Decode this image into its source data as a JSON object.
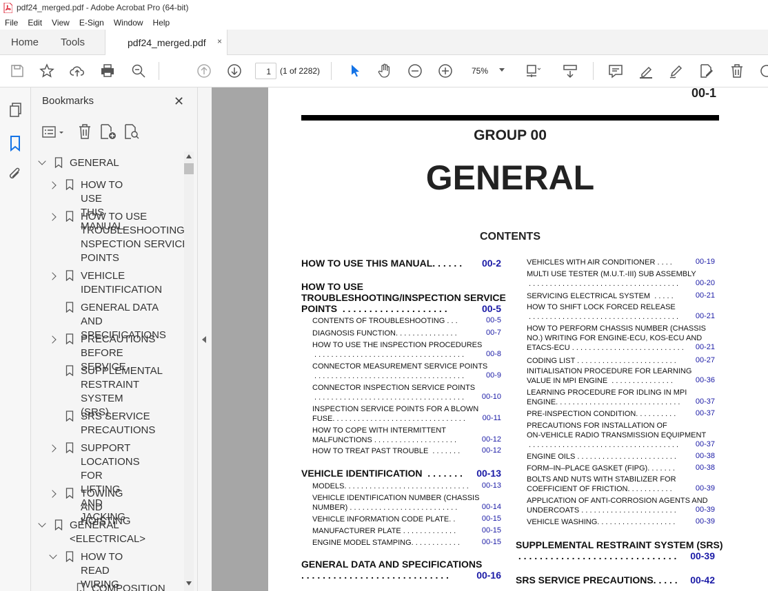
{
  "window": {
    "title": "pdf24_merged.pdf - Adobe Acrobat Pro (64-bit)"
  },
  "menu": [
    "File",
    "Edit",
    "View",
    "E-Sign",
    "Window",
    "Help"
  ],
  "tabs": {
    "home": "Home",
    "tools": "Tools",
    "doc": "pdf24_merged.pdf",
    "close": "×"
  },
  "toolbar": {
    "page": "1",
    "page_count": "(1 of 2282)",
    "zoom": "75%"
  },
  "bookmarks": {
    "title": "Bookmarks",
    "close": "✕",
    "items": [
      {
        "label": "GENERAL",
        "level": 0,
        "state": "open"
      },
      {
        "label": "HOW TO USE THIS\nMANUAL",
        "level": 1,
        "state": "closed"
      },
      {
        "label": "HOW TO USE\nTROUBLESHOOTING/I\nNSPECTION SERVICE\nPOINTS",
        "level": 1,
        "state": "closed"
      },
      {
        "label": "VEHICLE\nIDENTIFICATION",
        "level": 1,
        "state": "closed"
      },
      {
        "label": "GENERAL DATA AND\nSPECIFICATIONS",
        "level": 1,
        "state": "none"
      },
      {
        "label": "PRECAUTIONS\nBEFORE SERVICE",
        "level": 1,
        "state": "closed"
      },
      {
        "label": "SUPPLEMENTAL\nRESTRAINT SYSTEM\n(SRS)",
        "level": 1,
        "state": "none"
      },
      {
        "label": "SRS SERVICE\nPRECAUTIONS",
        "level": 1,
        "state": "none"
      },
      {
        "label": "SUPPORT LOCATIONS\nFOR LIFTING AND\nJACKING",
        "level": 1,
        "state": "closed"
      },
      {
        "label": "TOWING AND\nHOISTING",
        "level": 1,
        "state": "closed"
      },
      {
        "label": "GENERAL\n<ELECTRICAL>",
        "level": 0,
        "state": "open"
      },
      {
        "label": "HOW TO READ\nWIRING DIAGRAMS",
        "level": 1,
        "state": "open"
      },
      {
        "label": "COMPOSITION",
        "level": 2,
        "state": "none"
      }
    ]
  },
  "document": {
    "page_number": "00-1",
    "group": "GROUP 00",
    "title": "GENERAL",
    "contents": "CONTENTS",
    "left_column": [
      {
        "text": "HOW TO USE THIS MANUAL. . . . . .",
        "page": "00-2",
        "bold": true
      },
      {
        "text": "HOW TO USE\nTROUBLESHOOTING/INSPECTION SERVICE\nPOINTS  . . . . . . . . . . . . . . . . . . . .",
        "page": "00-5",
        "bold": true
      },
      {
        "text": "CONTENTS OF TROUBLESHOOTING . . .",
        "page": "00-5",
        "bold": false
      },
      {
        "text": "DIAGNOSIS FUNCTION. . . . . . . . . . . . . . .",
        "page": "00-7",
        "bold": false
      },
      {
        "text": "HOW TO USE THE INSPECTION PROCEDURES\n . . . . . . . . . . . . . . . . . . . . . . . . . . . . . . . . . . . .",
        "page": "00-8",
        "bold": false
      },
      {
        "text": "CONNECTOR MEASUREMENT SERVICE POINTS\n . . . . . . . . . . . . . . . . . . . . . . . . . . . . . . . . . . . .",
        "page": "00-9",
        "bold": false
      },
      {
        "text": "CONNECTOR INSPECTION SERVICE POINTS\n . . . . . . . . . . . . . . . . . . . . . . . . . . . . . . . . . . . .",
        "page": "00-10",
        "bold": false
      },
      {
        "text": "INSPECTION SERVICE POINTS FOR A BLOWN\nFUSE. . . . . . . . . . . . . . . . . . . . . . . . . . . . . . . .",
        "page": "00-11",
        "bold": false
      },
      {
        "text": "HOW TO COPE WITH INTERMITTENT\nMALFUNCTIONS . . . . . . . . . . . . . . . . . . . .",
        "page": "00-12",
        "bold": false
      },
      {
        "text": "HOW TO TREAT PAST TROUBLE  . . . . . . .",
        "page": "00-12",
        "bold": false
      },
      {
        "text": "VEHICLE IDENTIFICATION  . . . . . . .",
        "page": "00-13",
        "bold": true
      },
      {
        "text": "MODELS. . . . . . . . . . . . . . . . . . . . . . . . . . . . . .",
        "page": "00-13",
        "bold": false
      },
      {
        "text": "VEHICLE IDENTIFICATION NUMBER (CHASSIS\nNUMBER) . . . . . . . . . . . . . . . . . . . . . . . . . .",
        "page": "00-14",
        "bold": false
      },
      {
        "text": "VEHICLE INFORMATION CODE PLATE. .",
        "page": "00-15",
        "bold": false
      },
      {
        "text": "MANUFACTURER PLATE . . . . . . . . . . . . .",
        "page": "00-15",
        "bold": false
      },
      {
        "text": "ENGINE MODEL STAMPING. . . . . . . . . . . .",
        "page": "00-15",
        "bold": false
      },
      {
        "text": "GENERAL DATA AND SPECIFICATIONS\n. . . . . . . . . . . . . . . . . . . . . . . . . . . .",
        "page": "00-16",
        "bold": true
      }
    ],
    "right_column": [
      {
        "text": "VEHICLES WITH AIR CONDITIONER . . . .",
        "page": "00-19",
        "bold": false
      },
      {
        "text": "MULTI USE TESTER (M.U.T.-III) SUB ASSEMBLY\n . . . . . . . . . . . . . . . . . . . . . . . . . . . . . . . . . . . .",
        "page": "00-20",
        "bold": false
      },
      {
        "text": "SERVICING ELECTRICAL SYSTEM  . . . . .",
        "page": "00-21",
        "bold": false
      },
      {
        "text": "HOW TO SHIFT LOCK FORCED RELEASE\n . . . . . . . . . . . . . . . . . . . . . . . . . . . . . . . . . . . .",
        "page": "00-21",
        "bold": false
      },
      {
        "text": "HOW TO PERFORM CHASSIS NUMBER (CHASSIS\nNO.) WRITING FOR ENGINE-ECU, KOS-ECU AND\nETACS-ECU . . . . . . . . . . . . . . . . . . . . . . . . . . .",
        "page": "00-21",
        "bold": false
      },
      {
        "text": "CODING LIST . . . . . . . . . . . . . . . . . . . . . . . .",
        "page": "00-27",
        "bold": false
      },
      {
        "text": "INITIALISATION PROCEDURE FOR LEARNING\nVALUE IN MPI ENGINE  . . . . . . . . . . . . . . .",
        "page": "00-36",
        "bold": false
      },
      {
        "text": "LEARNING PROCEDURE FOR IDLING IN MPI\nENGINE. . . . . . . . . . . . . . . . . . . . . . . . . . . . . .",
        "page": "00-37",
        "bold": false
      },
      {
        "text": "PRE-INSPECTION CONDITION. . . . . . . . . .",
        "page": "00-37",
        "bold": false
      },
      {
        "text": "PRECAUTIONS FOR INSTALLATION OF\nON-VEHICLE RADIO TRANSMISSION EQUIPMENT\n . . . . . . . . . . . . . . . . . . . . . . . . . . . . . . . . . . . .",
        "page": "00-37",
        "bold": false
      },
      {
        "text": "ENGINE OILS . . . . . . . . . . . . . . . . . . . . . . . .",
        "page": "00-38",
        "bold": false
      },
      {
        "text": "FORM–IN–PLACE GASKET (FIPG). . . . . . .",
        "page": "00-38",
        "bold": false
      },
      {
        "text": "BOLTS AND NUTS WITH STABILIZER FOR\nCOEFFICIENT OF FRICTION. . . . . . . . . . .",
        "page": "00-39",
        "bold": false
      },
      {
        "text": "APPLICATION OF ANTI-CORROSION AGENTS AND\nUNDERCOATS . . . . . . . . . . . . . . . . . . . . . . .",
        "page": "00-39",
        "bold": false
      },
      {
        "text": "VEHICLE WASHING. . . . . . . . . . . . . . . . . . .",
        "page": "00-39",
        "bold": false
      },
      {
        "text": "SUPPLEMENTAL RESTRAINT SYSTEM (SRS)\n . . . . . . . . . . . . . . . . . . . . . . . . . . . . . .",
        "page": "00-39",
        "bold": true
      },
      {
        "text": "SRS SERVICE PRECAUTIONS. . . . .",
        "page": "00-42",
        "bold": true
      }
    ]
  },
  "colors": {
    "link": "#1a1aa6",
    "accent_blue": "#1473e6"
  }
}
